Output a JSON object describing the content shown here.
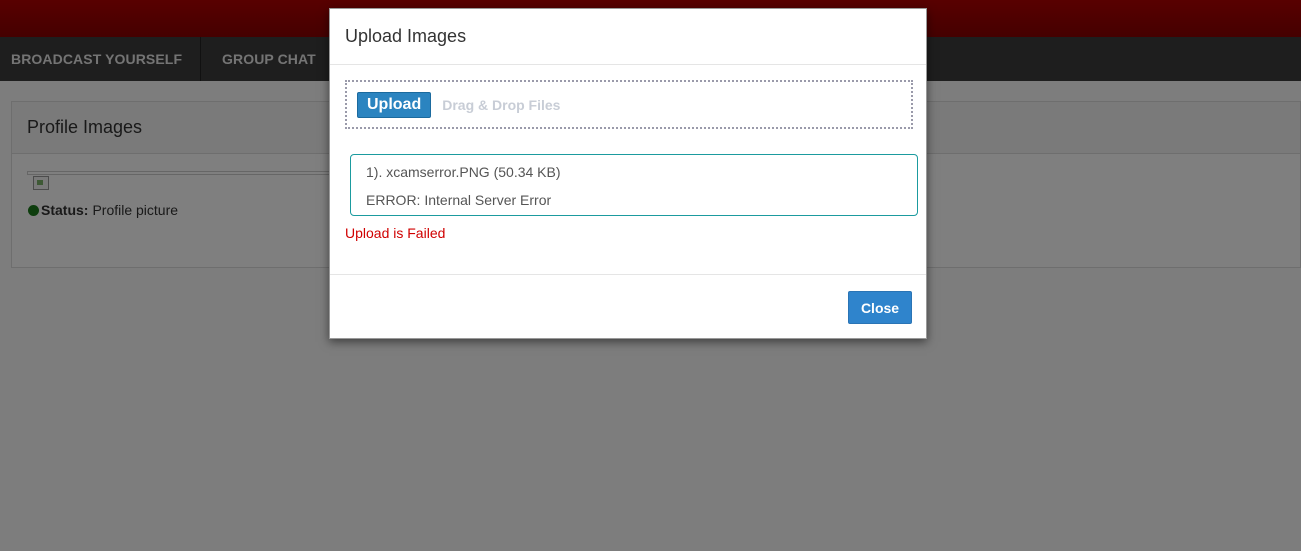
{
  "nav": {
    "items": [
      {
        "label": "BROADCAST YOURSELF"
      },
      {
        "label": "GROUP CHAT"
      }
    ]
  },
  "profile_panel": {
    "title": "Profile Images",
    "status_label": "Status:",
    "status_value": "Profile picture"
  },
  "modal": {
    "title": "Upload Images",
    "upload_button": "Upload",
    "drop_label": "Drag & Drop Files",
    "file": {
      "name_line": "1). xcamserror.PNG (50.34 KB)",
      "error_line": "ERROR: Internal Server Error"
    },
    "fail_message": "Upload is Failed",
    "close_button": "Close"
  },
  "colors": {
    "top_bar": "#a00000",
    "nav_bar": "#3c3c3c",
    "upload_button": "#2b84c0",
    "file_box_border": "#1b9b9f",
    "fail_text": "#d00000",
    "close_button": "#2f84cc",
    "status_dot": "#1a7a1a"
  }
}
